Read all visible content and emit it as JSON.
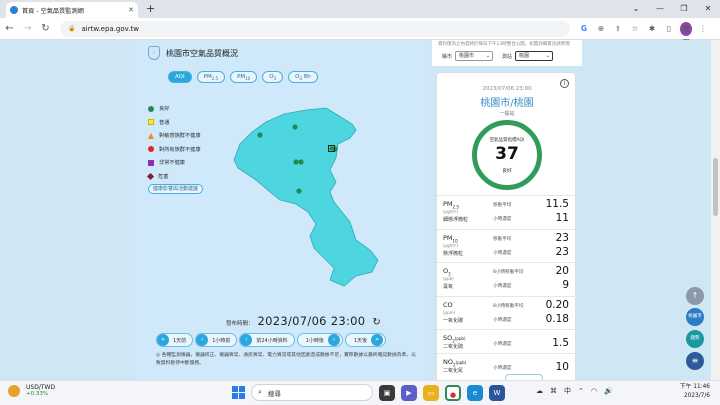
{
  "browser": {
    "tab_title": "首頁 - 空氣品質監測網",
    "new_tab": "+",
    "url": "airtw.epa.gov.tw",
    "profile": "使用"
  },
  "panel": {
    "title": "桃園市空氣品質概況",
    "pills": [
      "AQI",
      "PM2.5",
      "PM10",
      "O3",
      "O3 8h"
    ],
    "legend": [
      {
        "label": "良好",
        "shape": "dot",
        "color": "#1f8c4e"
      },
      {
        "label": "普通",
        "shape": "square",
        "color": "#f5e94a"
      },
      {
        "label": "對敏感族群不健康",
        "shape": "triangle",
        "color": "#f08a24"
      },
      {
        "label": "對所有族群不健康",
        "shape": "dot",
        "color": "#d92525"
      },
      {
        "label": "非常不健康",
        "shape": "square",
        "color": "#8b2fb0"
      },
      {
        "label": "危害",
        "shape": "diamond",
        "color": "#7a1f2b"
      }
    ],
    "legend_button": "健康影響與活動建議",
    "publish_label": "發布時間：",
    "publish_time": "2023/07/06 23:00",
    "time_buttons": {
      "minus_day": "1天前",
      "minus_hour": "1小時前",
      "history": "前24小時資料",
      "plus_hour": "1小時後",
      "plus_day": "1天後"
    },
    "note": "◎ 各種監測儀器，儀器校正、儀器異常、通訊異常、電力異常或其他因素造成數據不足，實際數據以最終確認數據為準。以致資料暫停中斷服務。"
  },
  "right_top": {
    "note": "資料僅為之內容將於每日下午13時整合公開，如需詳細資訊請參閱",
    "county_label": "縣市",
    "county_value": "桃園市",
    "station_label": "測站",
    "station_value": "桃園"
  },
  "station": {
    "datetime": "2023/07/06 23:00",
    "name": "桃園市/桃園",
    "type": "一般站",
    "aqi_label": "空氣品質指標AQI",
    "aqi_value": "37",
    "status": "良好",
    "pollutants": [
      {
        "name": "PM",
        "sub": "2.5",
        "unit": "(μg/m³)",
        "cname": "細懸浮微粒",
        "l1": "移動平均",
        "v1": "11.5",
        "l2": "小時濃度",
        "v2": "11"
      },
      {
        "name": "PM",
        "sub": "10",
        "unit": "(μg/m³)",
        "cname": "懸浮微粒",
        "l1": "移動平均",
        "v1": "23",
        "l2": "小時濃度",
        "v2": "23"
      },
      {
        "name": "O",
        "sub": "3",
        "unit": "(ppb)",
        "cname": "臭氧",
        "l1": "8小時移動平均",
        "v1": "20",
        "l2": "小時濃度",
        "v2": "9"
      },
      {
        "name": "CO",
        "sub": "",
        "unit": "(ppm)",
        "cname": "一氧化碳",
        "l1": "8小時移動平均",
        "v1": "0.20",
        "l2": "小時濃度",
        "v2": "0.18"
      },
      {
        "name": "SO",
        "sub": "2",
        "unit": "(ppb)",
        "cname": "二氧化硫",
        "l1": "小時濃度",
        "v1": "1.5",
        "l2": "",
        "v2": ""
      },
      {
        "name": "NO",
        "sub": "2",
        "unit": "(ppb)",
        "cname": "二氧化氮",
        "l1": "小時濃度",
        "v1": "10",
        "l2": "",
        "v2": ""
      }
    ]
  },
  "floating": {
    "county_btn": "桃園市",
    "trend_btn": "趨勢"
  },
  "taskbar": {
    "ticker": "USD/TWD",
    "change": "+0.33%",
    "search_placeholder": "搜尋",
    "time": "下午 11:46",
    "date": "2023/7/6"
  }
}
